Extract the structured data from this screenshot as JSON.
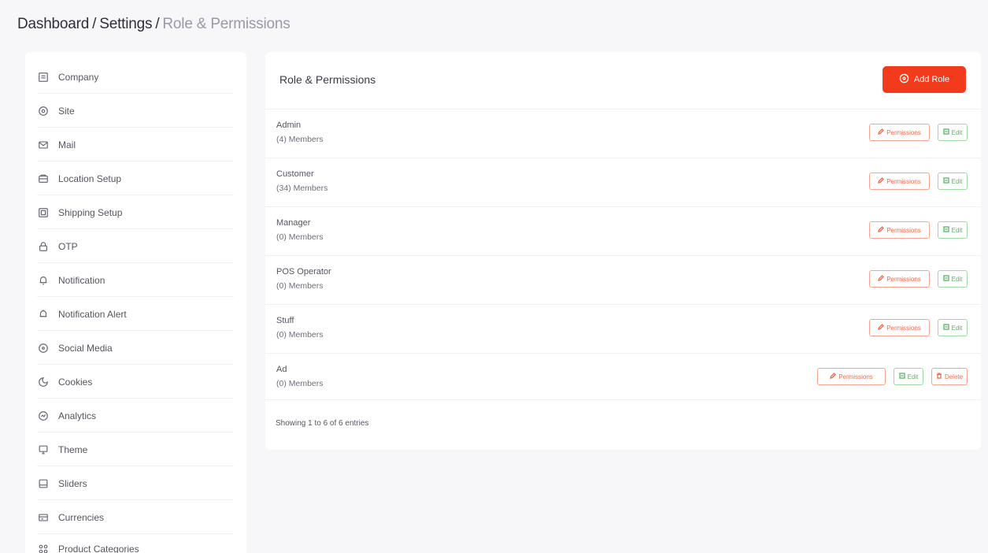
{
  "breadcrumb": {
    "items": [
      "Dashboard",
      "Settings"
    ],
    "separator": "/",
    "current": "Role & Permissions"
  },
  "sidebar": {
    "items": [
      {
        "label": "Company",
        "icon": "company-icon"
      },
      {
        "label": "Site",
        "icon": "site-icon"
      },
      {
        "label": "Mail",
        "icon": "mail-icon"
      },
      {
        "label": "Location Setup",
        "icon": "location-icon"
      },
      {
        "label": "Shipping Setup",
        "icon": "shipping-icon"
      },
      {
        "label": "OTP",
        "icon": "lock-icon"
      },
      {
        "label": "Notification",
        "icon": "bell-icon"
      },
      {
        "label": "Notification Alert",
        "icon": "bell-alert-icon"
      },
      {
        "label": "Social Media",
        "icon": "social-icon"
      },
      {
        "label": "Cookies",
        "icon": "cookie-icon"
      },
      {
        "label": "Analytics",
        "icon": "analytics-icon"
      },
      {
        "label": "Theme",
        "icon": "theme-icon"
      },
      {
        "label": "Sliders",
        "icon": "slider-icon"
      },
      {
        "label": "Currencies",
        "icon": "currency-icon"
      },
      {
        "label": "Product Categories",
        "icon": "grid-icon"
      }
    ]
  },
  "main": {
    "title": "Role & Permissions",
    "add_role_label": "Add Role",
    "permissions_label": "Permissions",
    "edit_label": "Edit",
    "delete_label": "Delete",
    "roles": [
      {
        "name": "Admin",
        "members": "(4) Members",
        "deletable": false
      },
      {
        "name": "Customer",
        "members": "(34) Members",
        "deletable": false
      },
      {
        "name": "Manager",
        "members": "(0) Members",
        "deletable": false
      },
      {
        "name": "POS Operator",
        "members": "(0) Members",
        "deletable": false
      },
      {
        "name": "Stuff",
        "members": "(0) Members",
        "deletable": false
      },
      {
        "name": "Ad",
        "members": "(0) Members",
        "deletable": true
      }
    ],
    "showing_text": "Showing 1 to 6 of 6 entries"
  },
  "colors": {
    "accent": "#f23b1c",
    "permission_outline": "#f6a593",
    "edit_outline": "#9ed9a5"
  }
}
